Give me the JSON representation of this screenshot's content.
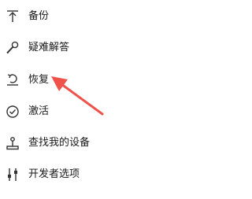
{
  "nav": {
    "items": [
      {
        "label": "备份",
        "icon": "backup-arrow-icon"
      },
      {
        "label": "疑难解答",
        "icon": "wrench-icon"
      },
      {
        "label": "恢复",
        "icon": "recovery-icon"
      },
      {
        "label": "激活",
        "icon": "check-circle-icon"
      },
      {
        "label": "查找我的设备",
        "icon": "find-device-icon"
      },
      {
        "label": "开发者选项",
        "icon": "developer-sliders-icon"
      }
    ]
  },
  "annotation": {
    "color": "#f0524a",
    "target": "恢复"
  }
}
